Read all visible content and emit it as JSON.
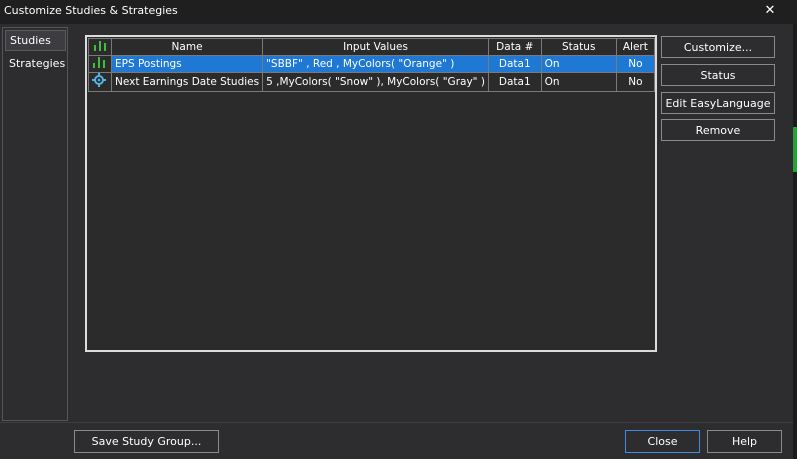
{
  "window": {
    "title": "Customize Studies & Strategies"
  },
  "sidebar": {
    "items": [
      {
        "label": "Studies"
      },
      {
        "label": "Strategies"
      }
    ]
  },
  "grid": {
    "columns": [
      "Name",
      "Input Values",
      "Data #",
      "Status",
      "Alert"
    ],
    "rows": [
      {
        "icon": "bar-chart-icon",
        "name": "EPS Postings",
        "inputs": "\"SBBF\" , Red , MyColors( \"Orange\" )",
        "data": "Data1",
        "status": "On",
        "alert": "No",
        "selected": true
      },
      {
        "icon": "gear-icon",
        "name": "Next Earnings Date Studies",
        "inputs": "5 ,MyColors( \"Snow\" ), MyColors( \"Gray\" )",
        "data": "Data1",
        "status": "On",
        "alert": "No",
        "selected": false
      }
    ]
  },
  "buttons": {
    "customize": "Customize...",
    "status": "Status",
    "edit_easylanguage": "Edit EasyLanguage",
    "remove": "Remove",
    "save_study_group": "Save Study Group...",
    "close": "Close",
    "help": "Help"
  },
  "colors": {
    "selection": "#1e78d4",
    "accent_green": "#2e9e3a",
    "primary_button_border": "#3c8fe0"
  }
}
